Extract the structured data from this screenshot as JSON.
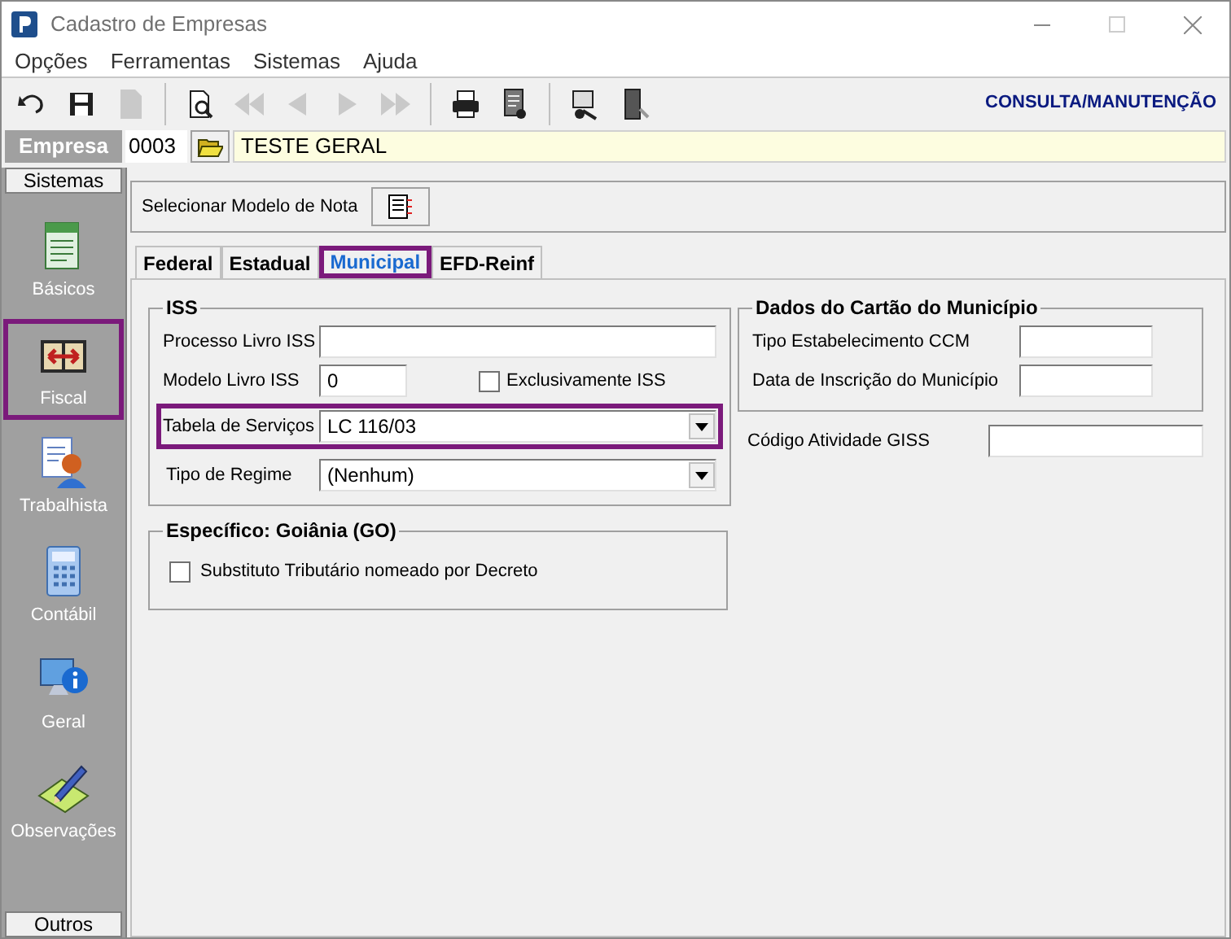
{
  "window": {
    "title": "Cadastro de Empresas"
  },
  "menu": [
    "Opções",
    "Ferramentas",
    "Sistemas",
    "Ajuda"
  ],
  "toolbar": [
    [
      {
        "kind": "undo",
        "disabled": false
      },
      {
        "kind": "save",
        "disabled": false
      },
      {
        "kind": "page",
        "disabled": true
      }
    ],
    [
      {
        "kind": "preview",
        "disabled": false
      },
      {
        "kind": "first",
        "disabled": true
      },
      {
        "kind": "prev",
        "disabled": true
      },
      {
        "kind": "next",
        "disabled": true
      },
      {
        "kind": "last",
        "disabled": true
      }
    ],
    [
      {
        "kind": "print",
        "disabled": false
      },
      {
        "kind": "report",
        "disabled": false
      }
    ],
    [
      {
        "kind": "tool",
        "disabled": false
      },
      {
        "kind": "exit",
        "disabled": false
      }
    ]
  ],
  "mode": "CONSULTA/MANUTENÇÃO",
  "empresa": {
    "label": "Empresa",
    "code": "0003",
    "name": "TESTE GERAL"
  },
  "sidebar": {
    "header": "Sistemas",
    "footer": "Outros",
    "items": [
      {
        "kind": "basicos",
        "label": "Básicos",
        "selected": false
      },
      {
        "kind": "fiscal",
        "label": "Fiscal",
        "selected": true
      },
      {
        "kind": "trabalhista",
        "label": "Trabalhista",
        "selected": false
      },
      {
        "kind": "contabil",
        "label": "Contábil",
        "selected": false
      },
      {
        "kind": "geral",
        "label": "Geral",
        "selected": false
      },
      {
        "kind": "observacoes",
        "label": "Observações",
        "selected": false
      }
    ]
  },
  "modelo_nota": {
    "label": "Selecionar Modelo de Nota"
  },
  "tabs": [
    {
      "label": "Federal",
      "selected": false
    },
    {
      "label": "Estadual",
      "selected": false
    },
    {
      "label": "Municipal",
      "selected": true
    },
    {
      "label": "EFD-Reinf",
      "selected": false
    }
  ],
  "iss": {
    "title": "ISS",
    "processo_livro": {
      "label": "Processo Livro ISS"
    },
    "modelo_livro": {
      "label": "Modelo Livro ISS",
      "value": "0"
    },
    "exclusivamente": {
      "label": "Exclusivamente ISS",
      "checked": false
    },
    "tabela_servicos": {
      "label": "Tabela de Serviços",
      "value": "LC 116/03",
      "highlighted": true
    },
    "tipo_regime": {
      "label": "Tipo de Regime",
      "value": "(Nenhum)"
    }
  },
  "especifico": {
    "title": "Específico: Goiânia (GO)",
    "substituto": {
      "label": "Substituto Tributário nomeado por Decreto",
      "checked": false
    }
  },
  "cartao": {
    "title": "Dados do Cartão do Município",
    "fields": [
      {
        "label": "Tipo Estabelecimento CCM"
      },
      {
        "label": "Data de Inscrição do Município"
      }
    ]
  },
  "giss": {
    "label": "Código Atividade GISS"
  }
}
